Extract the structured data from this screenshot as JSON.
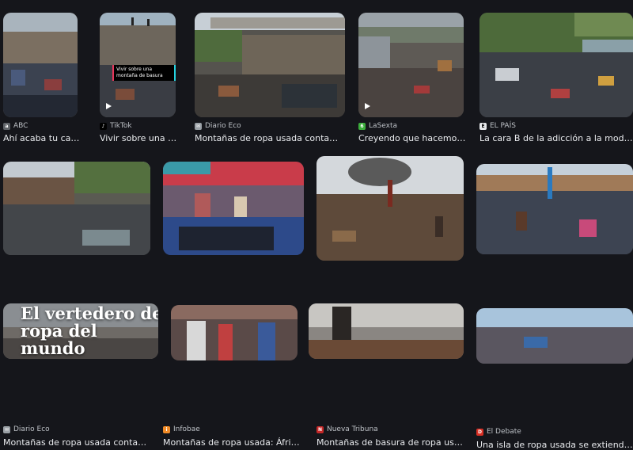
{
  "results": [
    {
      "source": "ABC",
      "title": "Ahí acaba tu cami…",
      "favicon": "abc-favicon",
      "favicon_color": "#5f6368",
      "video": false
    },
    {
      "source": "TikTok",
      "title": "Vivir sobre una mo…",
      "favicon": "tiktok-favicon",
      "favicon_color": "#000000",
      "video": true,
      "caption": "Vivir sobre una montaña de basura"
    },
    {
      "source": "Diario Eco",
      "title": "Montañas de ropa usada contamina…",
      "favicon": "mail-favicon",
      "favicon_color": "#9aa0a6",
      "video": false
    },
    {
      "source": "LaSexta",
      "title": "Creyendo que hacemos e…",
      "favicon": "lasexta-favicon",
      "favicon_color": "#3cae3c",
      "video": true
    },
    {
      "source": "EL PAÍS",
      "title": "La cara B de la adicción a la moda rá…",
      "favicon": "elpais-favicon",
      "favicon_color": "#e8eaed",
      "video": false
    },
    {
      "source": "Diario Eco",
      "title": "Montañas de ropa usada contamina…",
      "favicon": "mail-favicon",
      "favicon_color": "#9aa0a6",
      "video": false
    },
    {
      "source": "Infobae",
      "title": "Montañas de ropa usada: África \"…",
      "favicon": "infobae-favicon",
      "favicon_color": "#f28c28",
      "video": false
    },
    {
      "source": "Nueva Tribuna",
      "title": "Montañas de basura de ropa usada…",
      "favicon": "nuevatribuna-favicon",
      "favicon_color": "#c62828",
      "video": false
    },
    {
      "source": "El Debate",
      "title": "Una isla de ropa usada se extiende po…",
      "favicon": "eldebate-favicon",
      "favicon_color": "#d93025",
      "video": false
    },
    {
      "source": "",
      "title": "",
      "overlay": "El vertedero de ropa del mundo"
    },
    {
      "source": "",
      "title": ""
    },
    {
      "source": "",
      "title": ""
    },
    {
      "source": "",
      "title": ""
    }
  ]
}
